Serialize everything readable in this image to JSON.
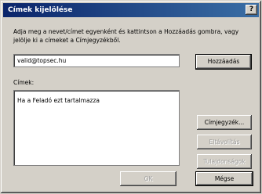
{
  "dialog": {
    "title": "Címek kijelölése",
    "help_label": "?"
  },
  "instruction": "Adja meg a nevet/címet egyenként és kattintson a Hozzáadás gombra, vagy jelölje ki a címeket a Címjegyzékből.",
  "address_input": {
    "value": "valid@topsec.hu"
  },
  "addresses": {
    "label": "Címek:",
    "items": [
      "Ha a Feladó ezt tartalmazza"
    ]
  },
  "buttons": {
    "add": "Hozzáadás",
    "address_book": "Címjegyzék...",
    "delete": "Eltávolítás",
    "properties": "Tulajdonságok",
    "ok": "OK",
    "cancel": "Mégse"
  }
}
